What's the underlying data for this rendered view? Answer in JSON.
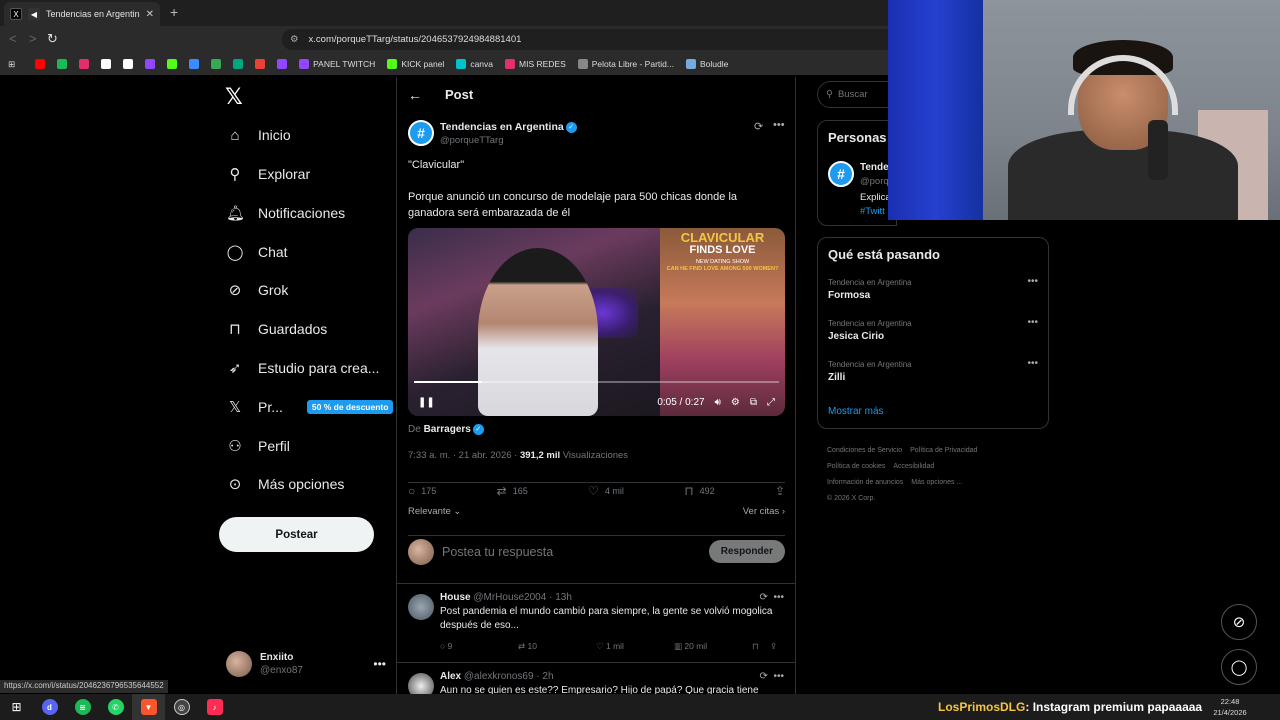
{
  "browser": {
    "tab_title": "Tendencias en Argentina en X",
    "url": "x.com/porqueTTarg/status/2046537924984881401",
    "bookmarks": [
      {
        "label": "",
        "color": "#ff0000"
      },
      {
        "label": "",
        "color": "#1db954"
      },
      {
        "label": "",
        "color": "#e1306c"
      },
      {
        "label": "",
        "color": "#ffffff"
      },
      {
        "label": "",
        "color": "#ffffff"
      },
      {
        "label": "",
        "color": "#9146ff"
      },
      {
        "label": "",
        "color": "#53fc18"
      },
      {
        "label": "",
        "color": "#3d8bff"
      },
      {
        "label": "",
        "color": "#34a853"
      },
      {
        "label": "",
        "color": "#00a67e"
      },
      {
        "label": "",
        "color": "#ea4335"
      },
      {
        "label": "",
        "color": "#9146ff"
      },
      {
        "label": "PANEL TWITCH",
        "color": "#9146ff"
      },
      {
        "label": "KICK panel",
        "color": "#53fc18"
      },
      {
        "label": "canva",
        "color": "#00c4cc"
      },
      {
        "label": "MIS REDES",
        "color": "#e1306c"
      },
      {
        "label": "Pelota Libre - Partid...",
        "color": "#888888"
      },
      {
        "label": "Boludle",
        "color": "#74acdf"
      }
    ]
  },
  "nav": {
    "items": [
      {
        "label": "Inicio",
        "icon": "home-icon"
      },
      {
        "label": "Explorar",
        "icon": "search-icon"
      },
      {
        "label": "Notificaciones",
        "icon": "bell-icon"
      },
      {
        "label": "Chat",
        "icon": "chat-icon"
      },
      {
        "label": "Grok",
        "icon": "grok-icon"
      },
      {
        "label": "Guardados",
        "icon": "bookmark-icon"
      },
      {
        "label": "Estudio para crea...",
        "icon": "rocket-icon"
      },
      {
        "label": "Pr...",
        "icon": "x-icon"
      },
      {
        "label": "Perfil",
        "icon": "person-icon"
      },
      {
        "label": "Más opciones",
        "icon": "more-circle-icon"
      }
    ],
    "premium_badge": "50 % de descuento",
    "post_button": "Postear",
    "account_name": "Enxiito",
    "account_handle": "@enxo87"
  },
  "post": {
    "header": "Post",
    "author_name": "Tendencias en Argentina",
    "author_handle": "@porqueTTarg",
    "text_line1": "\"Clavicular\"",
    "text_line2": "Porque anunció un concurso de modelaje para 500 chicas donde la ganadora será embarazada de él",
    "video": {
      "title1": "CLAVICULAR",
      "title2": "FINDS LOVE",
      "title3": "NEW DATING SHOW",
      "title4": "CAN HE FIND LOVE AMONG 500 WOMEN?",
      "time": "0:05 / 0:27",
      "progress": 0.185
    },
    "from_prefix": "De",
    "from_name": "Barragers",
    "time": "7:33 a. m. · 21 abr. 2026 ·",
    "views": "391,2 mil",
    "views_label": "Visualizaciones",
    "replies": "175",
    "reposts": "165",
    "likes": "4 mil",
    "bookmarks": "492",
    "sort_label": "Relevante",
    "quotes_label": "Ver citas",
    "reply_placeholder": "Postea tu respuesta",
    "reply_button": "Responder"
  },
  "replies": [
    {
      "name": "House",
      "handle": "@MrHouse2004 · 13h",
      "text": "Post pandemia el mundo cambió para siempre, la gente se volvió mogolica después de eso...",
      "replies": "9",
      "reposts": "10",
      "likes": "1 mil",
      "views": "20 mil"
    },
    {
      "name": "Alex",
      "handle": "@alexkronos69 · 2h",
      "text": "Aun no se quien es este?? Empresario? Hijo de papá? Que gracia tiene para"
    }
  ],
  "sidebar": {
    "search_placeholder": "Buscar",
    "people_title": "Personas",
    "people_name": "Tende",
    "people_handle": "@porq",
    "people_bio": "Explica",
    "people_tag": "#Twitt",
    "trends_title": "Qué está pasando",
    "trends": [
      {
        "category": "Tendencia en Argentina",
        "name": "Formosa"
      },
      {
        "category": "Tendencia en Argentina",
        "name": "Jesica Cirio"
      },
      {
        "category": "Tendencia en Argentina",
        "name": "Zilli"
      }
    ],
    "show_more": "Mostrar más",
    "footer_links": [
      "Condiciones de Servicio",
      "Política de Privacidad",
      "Política de cookies",
      "Accesibilidad",
      "Información de anuncios",
      "Más opciones ...",
      "© 2026 X Corp."
    ]
  },
  "status_url": "https://x.com/i/status/2046236796535644552",
  "taskbar": {
    "ticker_user": "LosPrimosDLG",
    "ticker_text": ": Instagram premium papaaaaa",
    "clock_time": "22:48",
    "clock_date": "21/4/2026"
  }
}
